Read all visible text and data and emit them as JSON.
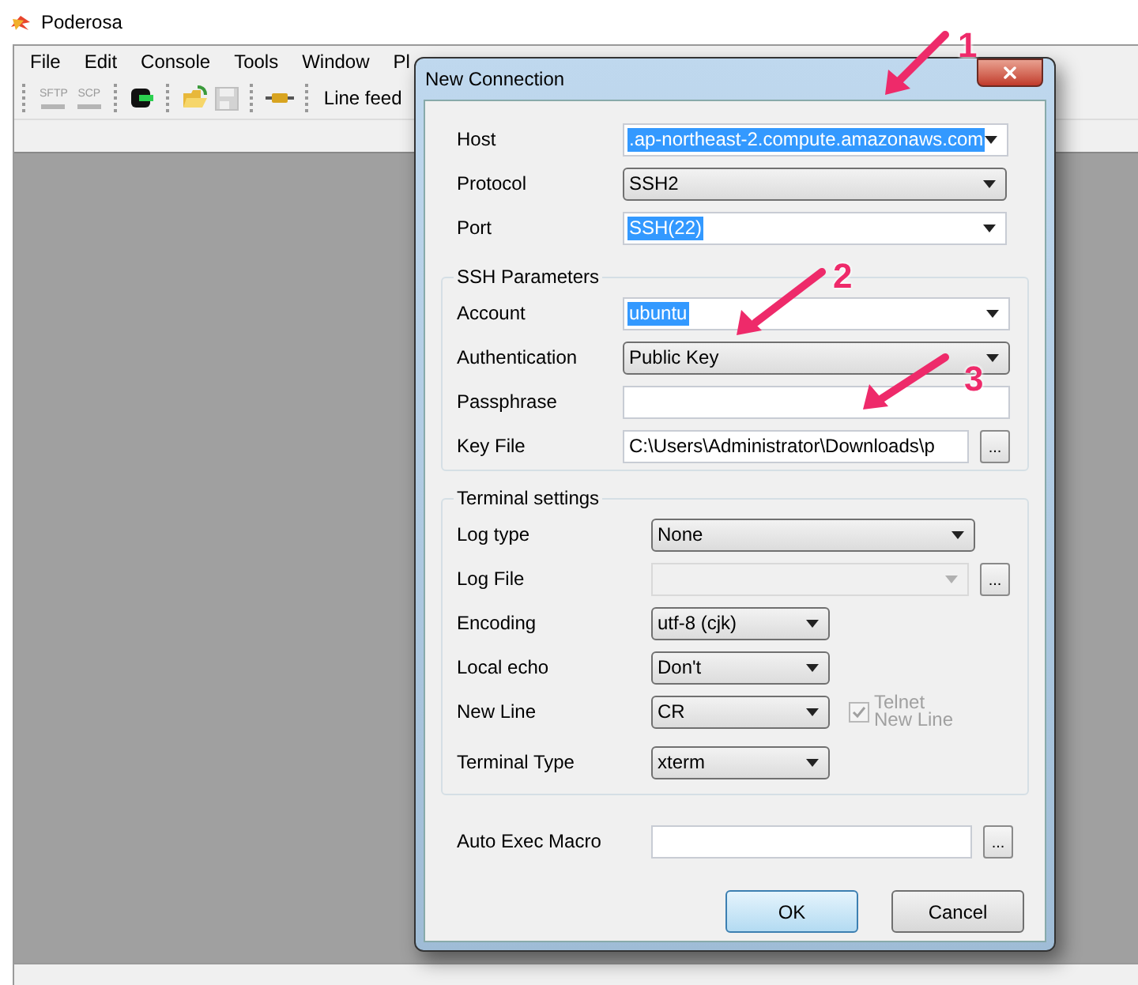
{
  "window": {
    "title": "Poderosa"
  },
  "menu": [
    {
      "label": "File"
    },
    {
      "label": "Edit"
    },
    {
      "label": "Console"
    },
    {
      "label": "Tools"
    },
    {
      "label": "Window"
    },
    {
      "label": "Pl"
    }
  ],
  "toolbar": {
    "items": [
      {
        "kind": "sftp",
        "label": "SFTP",
        "disabled": true
      },
      {
        "kind": "scp",
        "label": "SCP",
        "disabled": true
      },
      {
        "kind": "connect",
        "disabled": false
      },
      {
        "kind": "open",
        "disabled": false
      },
      {
        "kind": "save",
        "disabled": true
      },
      {
        "kind": "plug",
        "disabled": false
      }
    ],
    "line_feed_label": "Line feed"
  },
  "dialog": {
    "title": "New Connection",
    "sections": [
      {
        "rows": [
          {
            "label": "Host",
            "kind": "combo",
            "value": ".ap-northeast-2.compute.amazonaws.com",
            "highlighted": true
          },
          {
            "label": "Protocol",
            "kind": "dropdown",
            "value": "SSH2",
            "highlighted": false
          },
          {
            "label": "Port",
            "kind": "combo",
            "value": "SSH(22)",
            "highlighted": true
          }
        ]
      },
      {
        "heading": "SSH Parameters",
        "rows": [
          {
            "label": "Account",
            "kind": "combo",
            "value": "ubuntu",
            "highlighted": true
          },
          {
            "label": "Authentication",
            "kind": "dropdown",
            "value": "Public Key",
            "highlighted": false
          },
          {
            "label": "Passphrase",
            "kind": "text"
          },
          {
            "label": "Key File",
            "kind": "text",
            "value": "C:\\Users\\Administrator\\Downloads\\p",
            "highlighted": false,
            "button": "..."
          }
        ]
      },
      {
        "heading": "Terminal settings",
        "rows": [
          {
            "label": "Log type",
            "kind": "dropdown",
            "value": "None",
            "highlighted": false
          },
          {
            "label": "Log File",
            "kind": "combo",
            "disabled": true,
            "button": "..."
          },
          {
            "label": "Encoding",
            "kind": "short_dropdown",
            "value": "utf-8 (cjk)",
            "highlighted": false
          },
          {
            "label": "Local echo",
            "kind": "short_dropdown",
            "value": "Don't",
            "highlighted": false
          },
          {
            "label": "New Line",
            "kind": "short_dropdown",
            "value": "CR",
            "highlighted": false,
            "checkbox": {
              "label": "Telnet New Line",
              "checked": true,
              "disabled": true
            }
          },
          {
            "label": "Terminal Type",
            "kind": "short_dropdown",
            "value": "xterm",
            "highlighted": false
          }
        ]
      },
      {
        "rows": [
          {
            "label": "Auto Exec Macro",
            "kind": "text",
            "button": "..."
          }
        ]
      }
    ],
    "buttons": [
      {
        "label": "OK",
        "default": true
      },
      {
        "label": "Cancel",
        "default": false
      }
    ]
  },
  "annotations": [
    {
      "label": "1"
    },
    {
      "label": "2"
    },
    {
      "label": "3"
    }
  ]
}
